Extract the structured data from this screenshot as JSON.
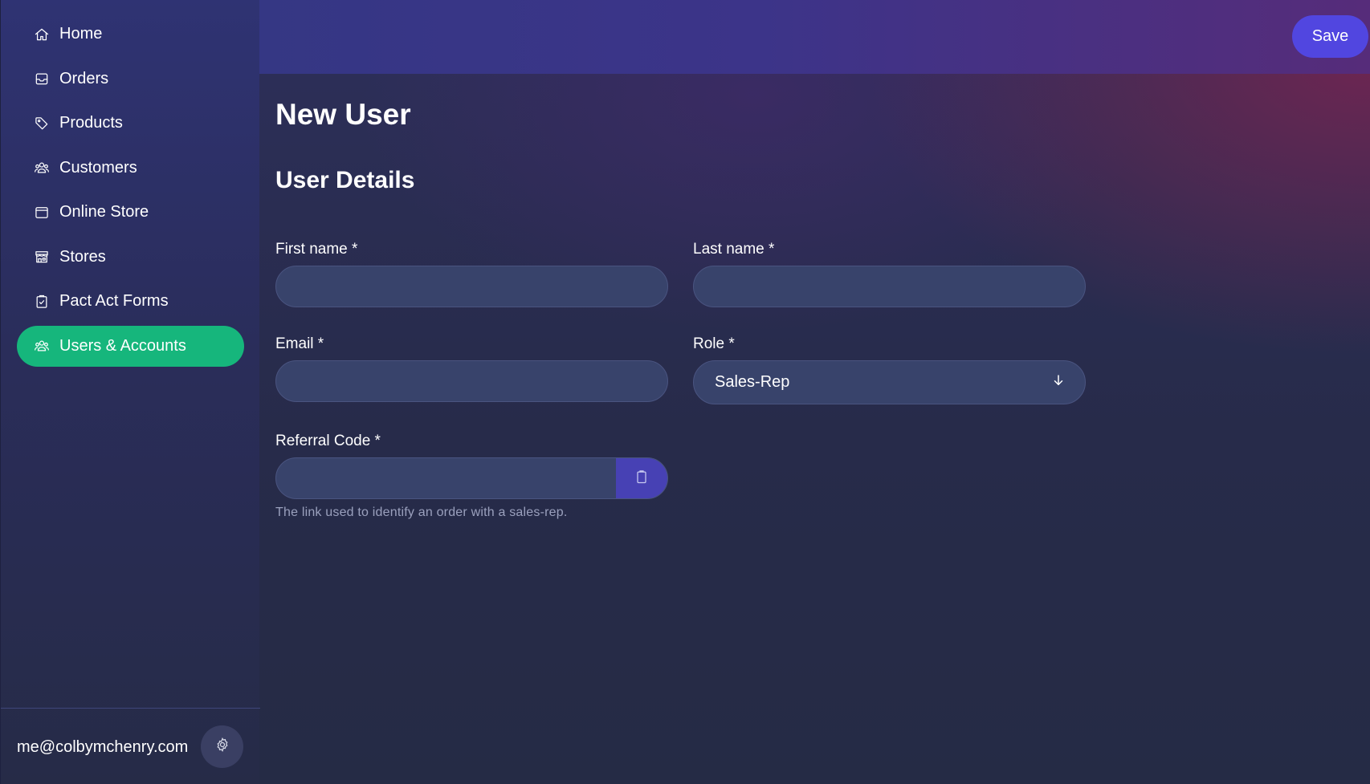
{
  "sidebar": {
    "items": [
      {
        "label": "Home",
        "icon": "home-icon"
      },
      {
        "label": "Orders",
        "icon": "inbox-icon"
      },
      {
        "label": "Products",
        "icon": "tag-icon"
      },
      {
        "label": "Customers",
        "icon": "user-group-icon"
      },
      {
        "label": "Online Store",
        "icon": "browser-window-icon"
      },
      {
        "label": "Stores",
        "icon": "storefront-icon"
      },
      {
        "label": "Pact Act Forms",
        "icon": "clipboard-check-icon"
      },
      {
        "label": "Users & Accounts",
        "icon": "user-group-icon",
        "active": true
      }
    ],
    "footer": {
      "email": "me@colbymchenry.com",
      "settings_icon": "gear-icon"
    }
  },
  "header": {
    "save_label": "Save"
  },
  "main": {
    "page_title": "New User",
    "section_title": "User Details",
    "fields": {
      "first_name": {
        "label": "First name *",
        "value": ""
      },
      "last_name": {
        "label": "Last name *",
        "value": ""
      },
      "email": {
        "label": "Email *",
        "value": ""
      },
      "role": {
        "label": "Role *",
        "value": "Sales-Rep",
        "icon": "arrow-down-icon"
      },
      "referral_code": {
        "label": "Referral Code *",
        "value": "",
        "help": "The link used to identify an order with a sales-rep.",
        "icon": "clipboard-icon"
      }
    }
  },
  "colors": {
    "accent_active": "#16b67c",
    "save_button": "#5146e0",
    "input_bg": "#38436b"
  }
}
